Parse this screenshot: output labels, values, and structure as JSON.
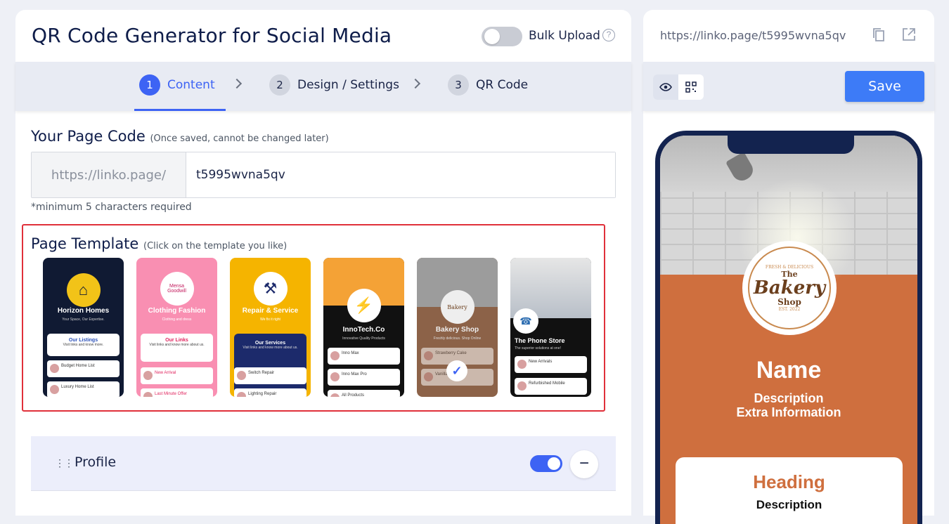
{
  "header": {
    "title": "QR Code Generator for Social Media",
    "bulk_label": "Bulk Upload",
    "help": "?"
  },
  "steps": [
    {
      "num": "1",
      "label": "Content",
      "active": true
    },
    {
      "num": "2",
      "label": "Design / Settings",
      "active": false
    },
    {
      "num": "3",
      "label": "QR Code",
      "active": false
    }
  ],
  "page_code": {
    "label": "Your Page Code",
    "note": "(Once saved, cannot be changed later)",
    "prefix": "https://linko.page/",
    "value": "t5995wvna5qv",
    "hint": "*minimum 5 characters required"
  },
  "template": {
    "label": "Page Template",
    "note": "(Click on the template you like)",
    "items": [
      {
        "name": "Horizon Homes",
        "tag": "Your Space, Our Expertise.",
        "card_title": "Our Listings",
        "card_text": "Visit links and know more.",
        "row1": "Budget Home List",
        "row2": "Luxury Home List"
      },
      {
        "name": "Clothing Fashion",
        "tag": "Clothing and dress",
        "logo_text": "Mensa Goodwill",
        "card_title": "Our Links",
        "card_text": "Visit links and know more about us.",
        "row1": "New Arrival",
        "row2": "Last Minute Offer"
      },
      {
        "name": "Repair & Service",
        "tag": "We fix it right",
        "card_title": "Our Services",
        "card_text": "Visit links and know more about us.",
        "row1": "Switch Repair",
        "row2": "Lighting Repair"
      },
      {
        "name": "InnoTech.Co",
        "tag": "Innovative Quality Products",
        "row1": "Inno Max",
        "row2": "Inno Max Pro",
        "row3": "All Products"
      },
      {
        "name": "Bakery Shop",
        "tag": "Freshly delicious. Shop Online",
        "row1": "Strawberry Cake",
        "row2": "Vanilla Cake",
        "selected": true
      },
      {
        "name": "The Phone Store",
        "tag": "The superior solutions at one!",
        "row1": "New Arrivals",
        "row2": "Refurbished Mobile"
      }
    ]
  },
  "profile": {
    "label": "Profile",
    "enabled": true
  },
  "preview": {
    "url": "https://linko.page/t5995wvna5qv",
    "save_label": "Save",
    "brand_small": "FRESH & DELICIOUS",
    "brand_the": "The",
    "brand_main": "Bakery",
    "brand_sub": "Shop",
    "brand_est": "EST. 2022",
    "name": "Name",
    "description": "Description",
    "extra": "Extra Information",
    "heading": "Heading",
    "card_description": "Description"
  },
  "colors": {
    "accent": "#3d63f4",
    "save": "#3d7bf7",
    "bakery": "#cf6f3e",
    "phone_frame": "#13234f",
    "highlight": "#e0303a"
  },
  "icons": [
    "help-icon",
    "copy-icon",
    "external-link-icon",
    "eye-icon",
    "qr-icon",
    "drag-icon",
    "check-icon",
    "minus-icon"
  ]
}
